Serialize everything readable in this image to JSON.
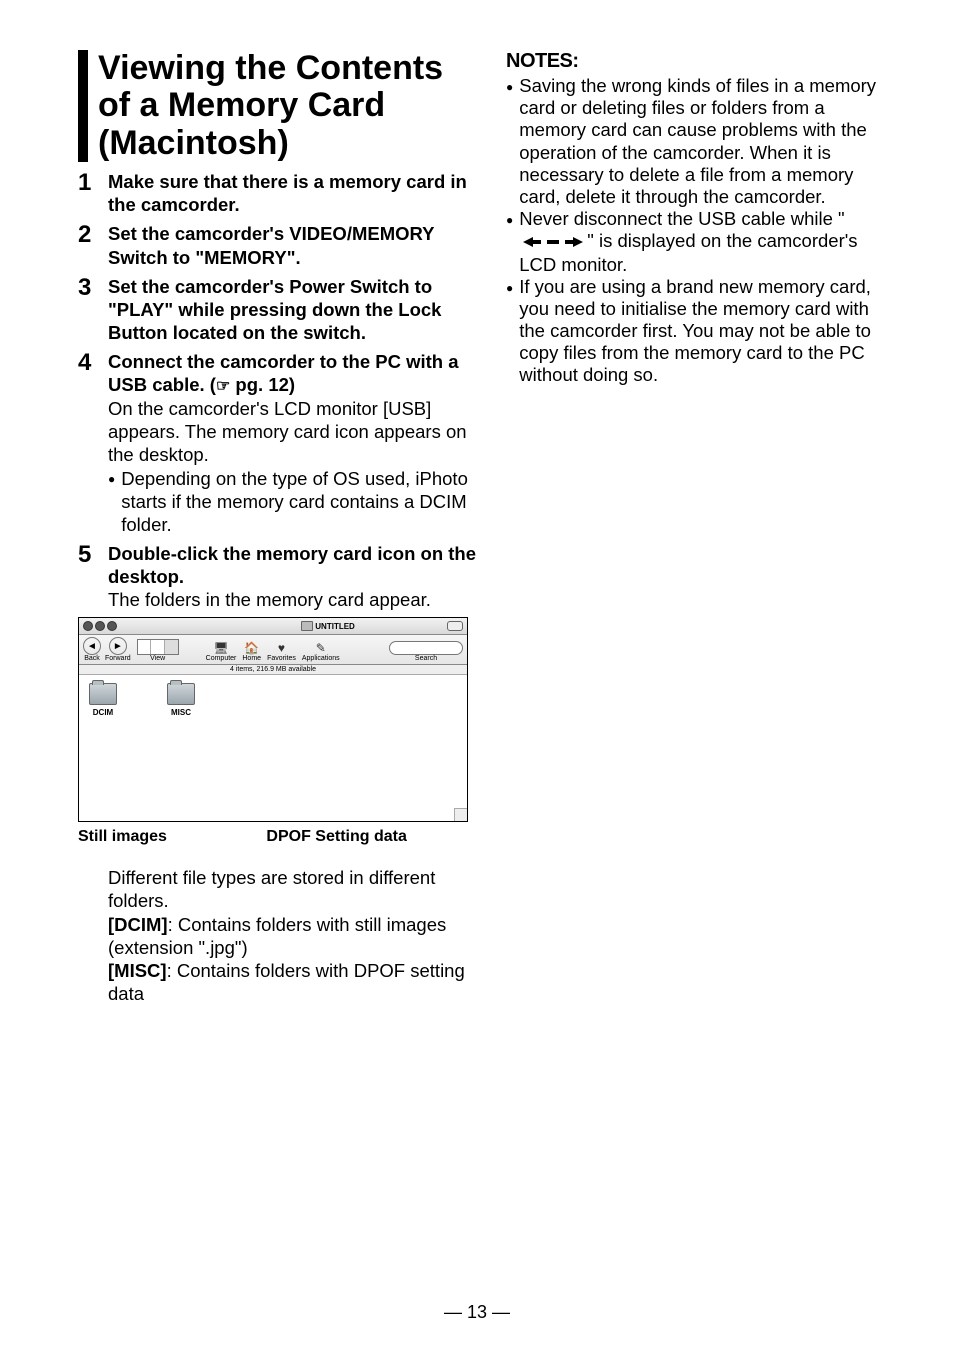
{
  "heading": "Viewing the Contents of a Memory Card (Macintosh)",
  "steps": [
    {
      "num": "1",
      "title": "Make sure that there is a memory card in the camcorder."
    },
    {
      "num": "2",
      "title": "Set the camcorder's VIDEO/MEMORY Switch to \"MEMORY\"."
    },
    {
      "num": "3",
      "title": "Set the camcorder's Power Switch to \"PLAY\" while pressing down the Lock Button located on the switch."
    },
    {
      "num": "4",
      "title_pre": "Connect the camcorder to the PC with a USB cable. (",
      "title_post": " pg. 12)",
      "desc": "On the camcorder's LCD monitor [USB] appears. The memory card icon appears on the desktop.",
      "bullet": "Depending on the type of OS used, iPhoto starts if the memory card contains a DCIM folder."
    },
    {
      "num": "5",
      "title": "Double-click the memory card icon on the desktop.",
      "desc": "The folders in the memory card appear."
    }
  ],
  "finder": {
    "title": "UNTITLED",
    "toolbar": {
      "back": "Back",
      "forward": "Forward",
      "view": "View",
      "computer": "Computer",
      "home": "Home",
      "favorites": "Favorites",
      "applications": "Applications",
      "search": "Search"
    },
    "status": "4 items, 216.9 MB available",
    "items": [
      "DCIM",
      "MISC"
    ]
  },
  "callouts": {
    "left": "Still images",
    "right": "DPOF Setting data"
  },
  "post_image": {
    "intro": "Different file types are stored in different folders.",
    "dcim_label": "[DCIM]",
    "dcim_text": ": Contains folders with still images (extension \".jpg\")",
    "misc_label": "[MISC]",
    "misc_text": ": Contains folders with DPOF setting data"
  },
  "notes": {
    "heading": "NOTES:",
    "items": [
      "Saving the wrong kinds of files in a memory card or deleting files or folders from a memory card can cause problems with the operation of the camcorder. When it is necessary to delete a file from a memory card, delete it through the camcorder.",
      "USB_ARROWS",
      "If you are using a brand new memory card, you need to initialise the memory card with the camcorder first. You may not be able to copy files from the memory card to the PC without doing so."
    ],
    "usb_pre": "Never disconnect the USB cable while \"",
    "usb_post": "\" is displayed on the camcorder's LCD monitor."
  },
  "page_number": "— 13 —"
}
